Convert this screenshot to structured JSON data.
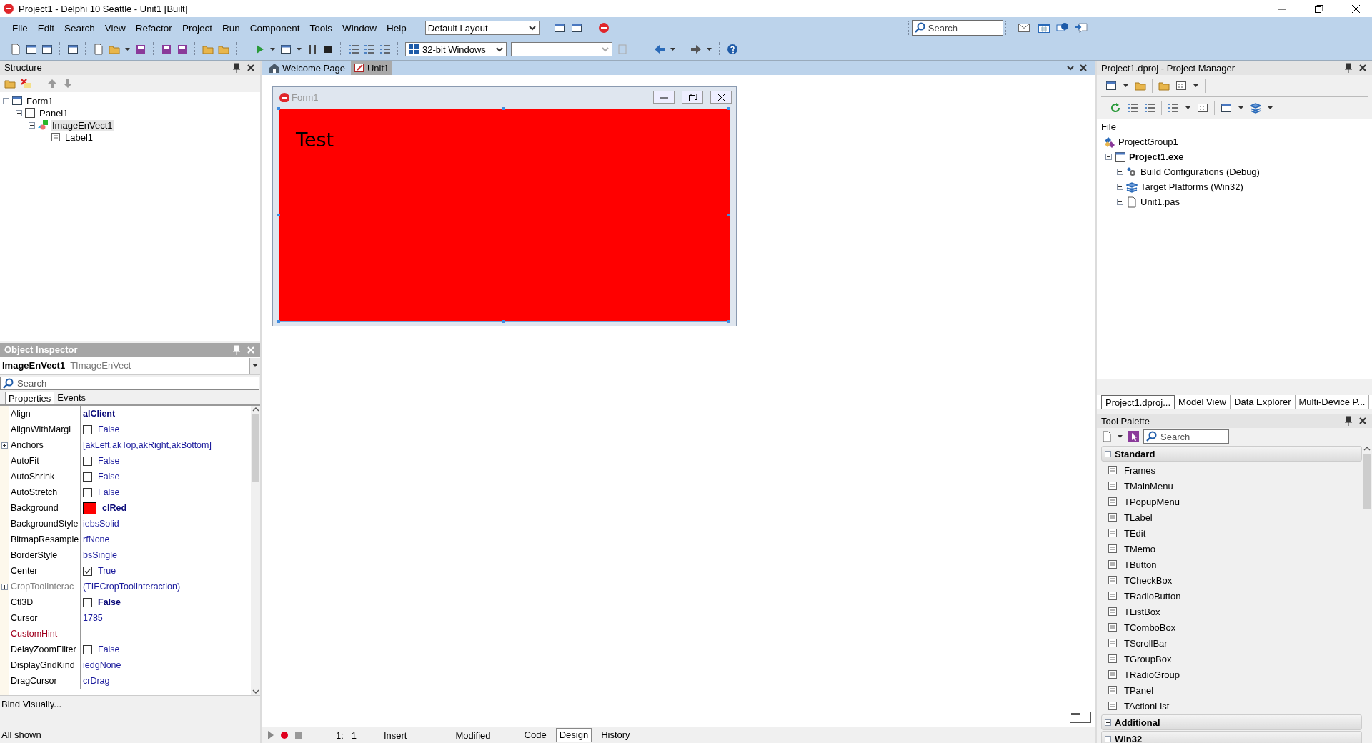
{
  "window": {
    "title": "Project1 - Delphi 10 Seattle - Unit1 [Built]"
  },
  "menu": [
    "File",
    "Edit",
    "Search",
    "View",
    "Refactor",
    "Project",
    "Run",
    "Component",
    "Tools",
    "Window",
    "Help"
  ],
  "layout_combo": {
    "value": "Default Layout"
  },
  "ide_search": {
    "placeholder": "Search"
  },
  "platform_combo": {
    "value": "32-bit Windows"
  },
  "structure": {
    "title": "Structure",
    "tree": [
      {
        "label": "Form1",
        "selected": false,
        "expanded": true,
        "children": [
          {
            "label": "Panel1",
            "selected": false,
            "expanded": true,
            "children": [
              {
                "label": "ImageEnVect1",
                "selected": true,
                "expanded": true,
                "children": [
                  {
                    "label": "Label1",
                    "selected": false
                  }
                ]
              }
            ]
          }
        ]
      }
    ]
  },
  "object_inspector": {
    "title": "Object Inspector",
    "component": "ImageEnVect1",
    "component_type": "TImageEnVect",
    "search": {
      "placeholder": "Search"
    },
    "tabs": [
      {
        "label": "Properties",
        "selected": true
      },
      {
        "label": "Events",
        "selected": false
      }
    ],
    "properties": [
      {
        "name": "Align",
        "kind": "text",
        "value": "alClient",
        "modified": true
      },
      {
        "name": "AlignWithMargi",
        "kind": "checkbox",
        "value": "False",
        "checked": false,
        "modified": false
      },
      {
        "name": "Anchors",
        "kind": "text",
        "value": "[akLeft,akTop,akRight,akBottom]",
        "modified": false,
        "expandable": true
      },
      {
        "name": "AutoFit",
        "kind": "checkbox",
        "value": "False",
        "checked": false,
        "modified": false
      },
      {
        "name": "AutoShrink",
        "kind": "checkbox",
        "value": "False",
        "checked": false,
        "modified": false
      },
      {
        "name": "AutoStretch",
        "kind": "checkbox",
        "value": "False",
        "checked": false,
        "modified": false
      },
      {
        "name": "Background",
        "kind": "color",
        "value": "clRed",
        "color": "#ff0000",
        "modified": true
      },
      {
        "name": "BackgroundStyle",
        "kind": "text",
        "value": "iebsSolid",
        "modified": false
      },
      {
        "name": "BitmapResample",
        "kind": "text",
        "value": "rfNone",
        "modified": false
      },
      {
        "name": "BorderStyle",
        "kind": "text",
        "value": "bsSingle",
        "modified": false
      },
      {
        "name": "Center",
        "kind": "checkbox",
        "value": "True",
        "checked": true,
        "modified": false
      },
      {
        "name": "CropToolInterac",
        "kind": "text",
        "value": "(TIECropToolInteraction)",
        "modified": false,
        "expandable": true,
        "disabled": true
      },
      {
        "name": "Ctl3D",
        "kind": "checkbox",
        "value": "False",
        "checked": false,
        "modified": true
      },
      {
        "name": "Cursor",
        "kind": "text",
        "value": "1785",
        "modified": false
      },
      {
        "name": "CustomHint",
        "kind": "text",
        "reference": true
      },
      {
        "name": "DelayZoomFilter",
        "kind": "checkbox",
        "value": "False",
        "checked": false,
        "modified": false
      },
      {
        "name": "DisplayGridKind",
        "kind": "text",
        "value": "iedgNone",
        "modified": false
      },
      {
        "name": "DragCursor",
        "kind": "text",
        "value": "crDrag",
        "modified": false
      }
    ],
    "bind_visually": "Bind Visually...",
    "status": "All shown"
  },
  "editor_tabs": [
    {
      "label": "Welcome Page",
      "selected": false
    },
    {
      "label": "Unit1",
      "selected": true
    }
  ],
  "form": {
    "title": "Form1",
    "label": "Test",
    "color": "#ff0000"
  },
  "status_bar": {
    "position": "1:   1",
    "mode": "Insert",
    "state": "Modified",
    "tabs": [
      {
        "label": "Code",
        "selected": false
      },
      {
        "label": "Design",
        "selected": true
      },
      {
        "label": "History",
        "selected": false
      }
    ]
  },
  "project_manager": {
    "title": "Project1.dproj - Project Manager",
    "column": "File",
    "tree": [
      {
        "label": "ProjectGroup1",
        "bold": false,
        "children": [
          {
            "label": "Project1.exe",
            "bold": true,
            "expanded": true,
            "children": [
              {
                "label": "Build Configurations (Debug)",
                "bold": false,
                "expanded": false
              },
              {
                "label": "Target Platforms (Win32)",
                "bold": false,
                "expanded": false
              },
              {
                "label": "Unit1.pas",
                "bold": false,
                "expanded": false
              }
            ]
          }
        ]
      }
    ],
    "tabs": [
      {
        "label": "Project1.dproj...",
        "selected": true
      },
      {
        "label": "Model View",
        "selected": false
      },
      {
        "label": "Data Explorer",
        "selected": false
      },
      {
        "label": "Multi-Device P...",
        "selected": false
      }
    ]
  },
  "tool_palette": {
    "title": "Tool Palette",
    "search": {
      "placeholder": "Search"
    },
    "categories": [
      {
        "label": "Standard",
        "expanded": true,
        "items": [
          "Frames",
          "TMainMenu",
          "TPopupMenu",
          "TLabel",
          "TEdit",
          "TMemo",
          "TButton",
          "TCheckBox",
          "TRadioButton",
          "TListBox",
          "TComboBox",
          "TScrollBar",
          "TGroupBox",
          "TRadioGroup",
          "TPanel",
          "TActionList"
        ]
      },
      {
        "label": "Additional",
        "expanded": false
      },
      {
        "label": "Win32",
        "expanded": false
      }
    ]
  }
}
